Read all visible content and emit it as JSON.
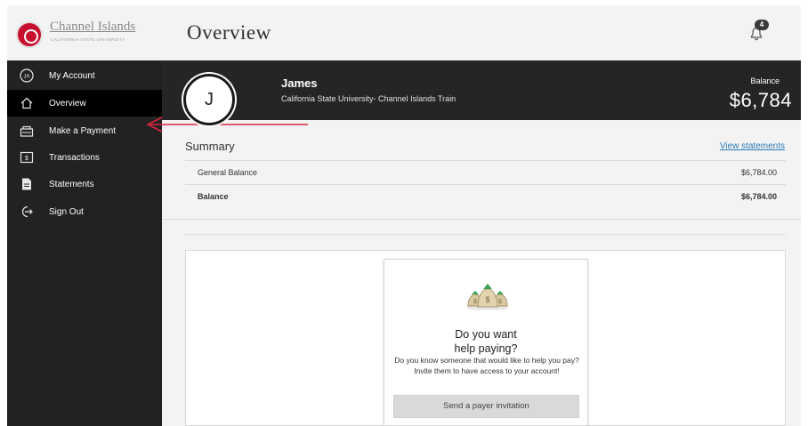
{
  "brand": {
    "name": "Channel Islands",
    "sub": "CALIFORNIA STATE UNIVERSITY"
  },
  "header": {
    "title": "Overview",
    "notification_count": "4"
  },
  "sidebar": {
    "items": [
      {
        "label": "My Account",
        "icon": "account-circle-icon"
      },
      {
        "label": "Overview",
        "icon": "home-icon"
      },
      {
        "label": "Make a Payment",
        "icon": "payment-icon"
      },
      {
        "label": "Transactions",
        "icon": "transactions-icon"
      },
      {
        "label": "Statements",
        "icon": "document-icon"
      },
      {
        "label": "Sign Out",
        "icon": "sign-out-icon"
      }
    ],
    "avatar_initials": "JA"
  },
  "account": {
    "avatar_initial": "J",
    "name": "James",
    "organization": "California State University- Channel Islands Train",
    "balance_label": "Balance",
    "balance_value": "$6,784"
  },
  "summary": {
    "title": "Summary",
    "view_statements": "View statements",
    "rows": [
      {
        "label": "General Balance",
        "value": "$6,784.00"
      },
      {
        "label": "Balance",
        "value": "$6,784.00"
      }
    ]
  },
  "help_card": {
    "title_line1": "Do you want",
    "title_line2": "help paying?",
    "text": "Do you know someone that would like to help you pay? Invite them to have access to your account!",
    "button": "Send a payer invitation"
  },
  "colors": {
    "sidebar": "#222222",
    "sidebar_active": "#000000",
    "banner": "#252525",
    "link": "#2a7ab8",
    "brand_red": "#c8102e",
    "annotation_arrow": "#d7263d"
  }
}
